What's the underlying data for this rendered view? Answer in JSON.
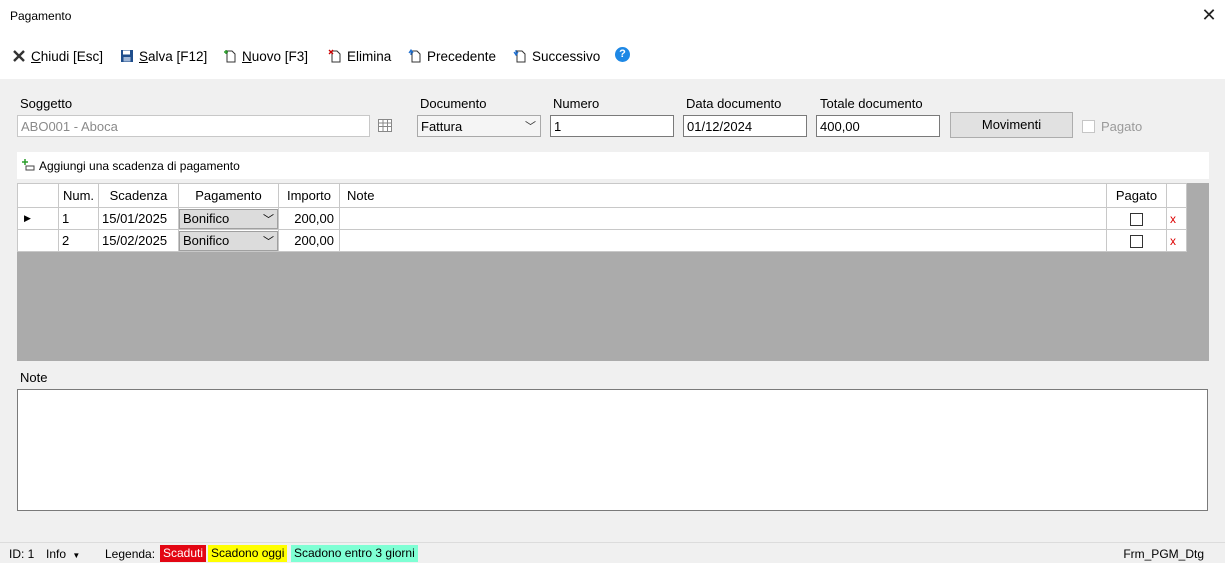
{
  "window": {
    "title": "Pagamento"
  },
  "toolbar": {
    "close": {
      "label": "Chiudi [Esc]",
      "mnemonic": "C"
    },
    "save": {
      "label": "Salva [F12]",
      "mnemonic": "S"
    },
    "new": {
      "label": "Nuovo [F3]",
      "mnemonic": "N"
    },
    "delete": {
      "label": "Elimina"
    },
    "previous": {
      "label": "Precedente"
    },
    "next": {
      "label": "Successivo"
    },
    "help": "?"
  },
  "form": {
    "subject_label": "Soggetto",
    "subject_value": "ABO001 - Aboca",
    "document_label": "Documento",
    "document_value": "Fattura",
    "number_label": "Numero",
    "number_value": "1",
    "date_label": "Data documento",
    "date_value": "01/12/2024",
    "total_label": "Totale documento",
    "total_value": "400,00",
    "movements_button": "Movimenti",
    "paid_label": "Pagato",
    "paid_checked": false
  },
  "add_installment": "Aggiungi una scadenza di pagamento",
  "grid": {
    "columns": [
      "Num.",
      "Scadenza",
      "Pagamento",
      "Importo",
      "Note",
      "Pagato"
    ],
    "rows": [
      {
        "num": "1",
        "due": "15/01/2025",
        "method": "Bonifico",
        "amount": "200,00",
        "note": "",
        "paid": false,
        "delete": "x"
      },
      {
        "num": "2",
        "due": "15/02/2025",
        "method": "Bonifico",
        "amount": "200,00",
        "note": "",
        "paid": false,
        "delete": "x"
      }
    ]
  },
  "notes_label": "Note",
  "notes_value": "",
  "status": {
    "id": "ID: 1",
    "info": "Info",
    "legend_label": "Legenda:",
    "legend": [
      {
        "label": "Scaduti",
        "bg": "#e30613",
        "fg": "#ffffff"
      },
      {
        "label": "Scadono oggi",
        "bg": "#ffff00",
        "fg": "#000000"
      },
      {
        "label": "Scadono entro 3 giorni",
        "bg": "#7fffd4",
        "fg": "#000000"
      }
    ],
    "form_name": "Frm_PGM_Dtg"
  }
}
